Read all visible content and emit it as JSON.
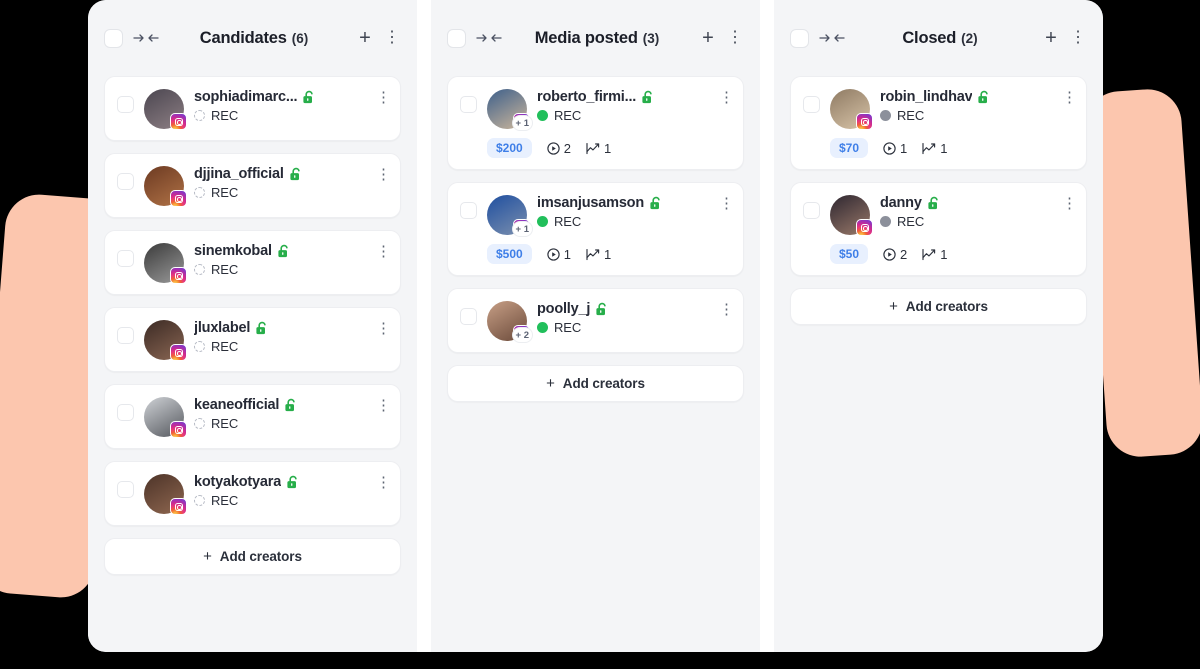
{
  "theme": {
    "board_bg": "#ffffff",
    "column_bg": "#f4f5f7",
    "page_bg": "#000000",
    "accent_peach": "#fcc6ae",
    "price_text": "#3f7fe8",
    "price_bg": "#e8f0fe",
    "status_active": "#21bf5b",
    "status_closed": "#8c909b",
    "status_pending": "#b8bcc6",
    "lock_green": "#27ae4a"
  },
  "add_button_label": "Add creators",
  "columns": [
    {
      "id": "candidates",
      "title": "Candidates",
      "count_label": "(6)",
      "header_icons": {
        "checkbox": "checkbox-icon",
        "collapse": "collapse-arrows-icon",
        "add": "+",
        "menu": "⋮"
      },
      "cards": [
        {
          "username": "sophiadimarc...",
          "lock": "unlocked-icon",
          "status": "REC",
          "status_type": "pending",
          "platform": "instagram-icon",
          "avatar_colors": [
            "#4b4650",
            "#8d7f84"
          ],
          "extra_count": null,
          "price": null,
          "stats": []
        },
        {
          "username": "djjina_official",
          "lock": "unlocked-icon",
          "status": "REC",
          "status_type": "pending",
          "platform": "instagram-icon",
          "avatar_colors": [
            "#6c3a22",
            "#b07246"
          ],
          "extra_count": null,
          "price": null,
          "stats": []
        },
        {
          "username": "sinemkobal",
          "lock": "unlocked-icon",
          "status": "REC",
          "status_type": "pending",
          "platform": "instagram-icon",
          "avatar_colors": [
            "#3a3a3a",
            "#9a9a9a"
          ],
          "extra_count": null,
          "price": null,
          "stats": []
        },
        {
          "username": "jluxlabel",
          "lock": "unlocked-icon",
          "status": "REC",
          "status_type": "pending",
          "platform": "instagram-icon",
          "avatar_colors": [
            "#3b2a24",
            "#8a6653"
          ],
          "extra_count": null,
          "price": null,
          "stats": []
        },
        {
          "username": "keaneofficial",
          "lock": "unlocked-icon",
          "status": "REC",
          "status_type": "pending",
          "platform": "instagram-icon",
          "avatar_colors": [
            "#cfd2d6",
            "#55585e"
          ],
          "extra_count": null,
          "price": null,
          "stats": []
        },
        {
          "username": "kotyakotyara",
          "lock": "unlocked-icon",
          "status": "REC",
          "status_type": "pending",
          "platform": "instagram-icon",
          "avatar_colors": [
            "#4c3328",
            "#8f6750"
          ],
          "extra_count": null,
          "price": null,
          "stats": []
        }
      ]
    },
    {
      "id": "media-posted",
      "title": "Media posted",
      "count_label": "(3)",
      "header_icons": {
        "checkbox": "checkbox-icon",
        "collapse": "collapse-arrows-icon",
        "add": "+",
        "menu": "⋮"
      },
      "cards": [
        {
          "username": "roberto_firmi...",
          "lock": "unlocked-icon",
          "status": "REC",
          "status_type": "active",
          "platform": "instagram-icon",
          "avatar_colors": [
            "#3d5f8a",
            "#cdb79c"
          ],
          "extra_count": "+ 1",
          "price": "$200",
          "stats": [
            {
              "icon": "play-circle-icon",
              "value": "2"
            },
            {
              "icon": "chart-line-icon",
              "value": "1"
            }
          ]
        },
        {
          "username": "imsanjusamson",
          "lock": "unlocked-icon",
          "status": "REC",
          "status_type": "active",
          "platform": "instagram-icon",
          "avatar_colors": [
            "#1f4fa0",
            "#7b8fae"
          ],
          "extra_count": "+ 1",
          "price": "$500",
          "stats": [
            {
              "icon": "play-circle-icon",
              "value": "1"
            },
            {
              "icon": "chart-line-icon",
              "value": "1"
            }
          ]
        },
        {
          "username": "poolly_j",
          "lock": "unlocked-icon",
          "status": "REC",
          "status_type": "active",
          "platform": "instagram-icon",
          "avatar_colors": [
            "#c79f86",
            "#6b4a3a"
          ],
          "extra_count": "+ 2",
          "price": null,
          "stats": []
        }
      ]
    },
    {
      "id": "closed",
      "title": "Closed",
      "count_label": "(2)",
      "header_icons": {
        "checkbox": "checkbox-icon",
        "collapse": "collapse-arrows-icon",
        "add": "+",
        "menu": "⋮"
      },
      "cards": [
        {
          "username": "robin_lindhav",
          "lock": "unlocked-icon",
          "status": "REC",
          "status_type": "closed",
          "platform": "instagram-icon",
          "avatar_colors": [
            "#8e7a63",
            "#d8c4a8"
          ],
          "extra_count": null,
          "price": "$70",
          "stats": [
            {
              "icon": "play-circle-icon",
              "value": "1"
            },
            {
              "icon": "chart-line-icon",
              "value": "1"
            }
          ]
        },
        {
          "username": "danny",
          "lock": "unlocked-icon",
          "status": "REC",
          "status_type": "closed",
          "platform": "instagram-icon",
          "avatar_colors": [
            "#2d2630",
            "#9b7a6a"
          ],
          "extra_count": null,
          "price": "$50",
          "stats": [
            {
              "icon": "play-circle-icon",
              "value": "2"
            },
            {
              "icon": "chart-line-icon",
              "value": "1"
            }
          ]
        }
      ]
    }
  ]
}
